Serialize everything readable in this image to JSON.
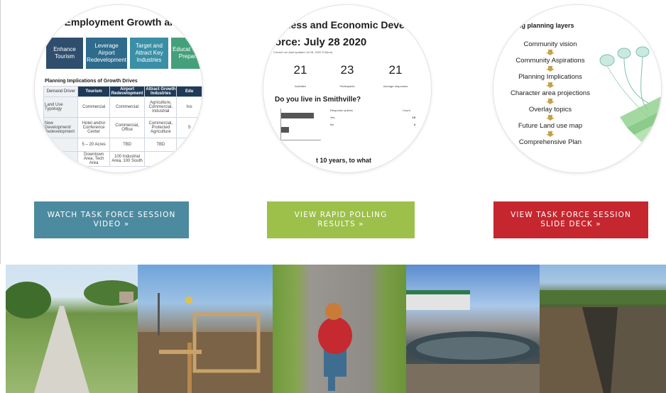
{
  "cards": [
    {
      "title": "al Employment Growth an",
      "demand_boxes": [
        "Enhance Tourism",
        "Leverage Airport Redevelopment",
        "Target and Attract Key Industries",
        "Educat Work Prepare"
      ],
      "subtitle": "Planning Implications of Growth Drives",
      "table": {
        "header": [
          "Demand Driver",
          "Tourism",
          "Airport Redevelopment",
          "Attract Growth Industries",
          "Edu"
        ],
        "rows": [
          [
            "Land Use Typology",
            "Commercial",
            "Commercial",
            "Agriculture, Commercial, Industrial",
            "Ins"
          ],
          [
            "New Development/ Redevelopment",
            "Hotel and/or Conference Center",
            "Commercial, Office",
            "Commercial, Protected Agriculture",
            "S"
          ],
          [
            "",
            "5 – 20 Acres",
            "TBD",
            "TBD",
            ""
          ],
          [
            "",
            "Downtown Area, Tech Area",
            "100 Industrial Area, 100 South",
            "",
            ""
          ]
        ]
      }
    },
    {
      "title_line1": "ness and Economic Deve",
      "title_line2": "orce: July 28 2020",
      "note": "Current run (last updated Jul 28, 2020 5:32pm)",
      "stats": [
        {
          "value": "21",
          "label": "Activities"
        },
        {
          "value": "23",
          "label": "Participants"
        },
        {
          "value": "21",
          "label": "Average responses"
        }
      ],
      "question": "Do you live in Smithville?",
      "response_header": "Response options",
      "count_header": "Count",
      "responses": [
        {
          "option": "Yes",
          "count": "19",
          "bar": 0.82
        },
        {
          "option": "No",
          "count": "4",
          "bar": 0.2
        }
      ],
      "bottom_text": "t 10 years, to what"
    },
    {
      "title": "ng planning layers",
      "layers": [
        "Community vision",
        "Community Aspirations",
        "Planning Implications",
        "Character area projections",
        "Overlay topics",
        "Future Land use map",
        "Comprehensive Plan"
      ]
    }
  ],
  "buttons": [
    {
      "label": "WATCH TASK FORCE SESSION VIDEO »",
      "color": "#4c8aa0"
    },
    {
      "label": "VIEW RAPID POLLING RESULTS »",
      "color": "#9cc04a"
    },
    {
      "label": "VIEW TASK FORCE SESSION SLIDE DECK »",
      "color": "#c6262e"
    }
  ]
}
